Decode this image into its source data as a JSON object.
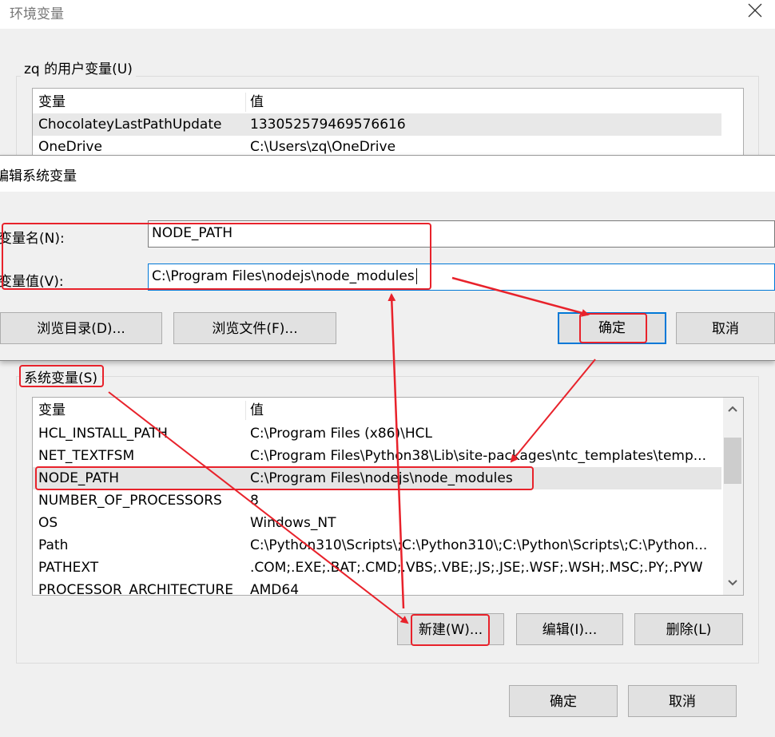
{
  "outer": {
    "title": "环境变量",
    "user_group_label": "zq 的用户变量(U)",
    "user_columns": [
      "变量",
      "值"
    ],
    "user_rows": [
      {
        "name": "ChocolateyLastPathUpdate",
        "value": "133052579469576616"
      },
      {
        "name": "OneDrive",
        "value": "C:\\Users\\zq\\OneDrive"
      }
    ],
    "system_group_label": "系统变量(S)",
    "system_columns": [
      "变量",
      "值"
    ],
    "system_rows": [
      {
        "name": "HCL_INSTALL_PATH",
        "value": "C:\\Program Files (x86)\\HCL"
      },
      {
        "name": "NET_TEXTFSM",
        "value": "C:\\Program Files\\Python38\\Lib\\site-packages\\ntc_templates\\temp..."
      },
      {
        "name": "NODE_PATH",
        "value": "C:\\Program Files\\nodejs\\node_modules"
      },
      {
        "name": "NUMBER_OF_PROCESSORS",
        "value": "8"
      },
      {
        "name": "OS",
        "value": "Windows_NT"
      },
      {
        "name": "Path",
        "value": "C:\\Python310\\Scripts\\;C:\\Python310\\;C:\\Python\\Scripts\\;C:\\Python..."
      },
      {
        "name": "PATHEXT",
        "value": ".COM;.EXE;.BAT;.CMD;.VBS;.VBE;.JS;.JSE;.WSF;.WSH;.MSC;.PY;.PYW"
      },
      {
        "name": "PROCESSOR_ARCHITECTURE",
        "value": "AMD64"
      }
    ],
    "new_button": "新建(W)...",
    "edit_button": "编辑(I)...",
    "delete_button": "删除(L)",
    "ok_button": "确定",
    "cancel_button": "取消"
  },
  "dialog": {
    "title": "编辑系统变量",
    "name_label": "变量名(N):",
    "name_value": "NODE_PATH",
    "value_label": "变量值(V):",
    "value_value": "C:\\Program Files\\nodejs\\node_modules",
    "browse_dir_button": "浏览目录(D)...",
    "browse_file_button": "浏览文件(F)...",
    "ok_button": "确定",
    "cancel_button": "取消"
  },
  "colors": {
    "annotation_red": "#e8222b",
    "focus_blue": "#0078d7",
    "selected_row": "#e5e5e5"
  },
  "icons": [
    "close-icon",
    "scroll-up-icon",
    "scroll-down-icon"
  ]
}
